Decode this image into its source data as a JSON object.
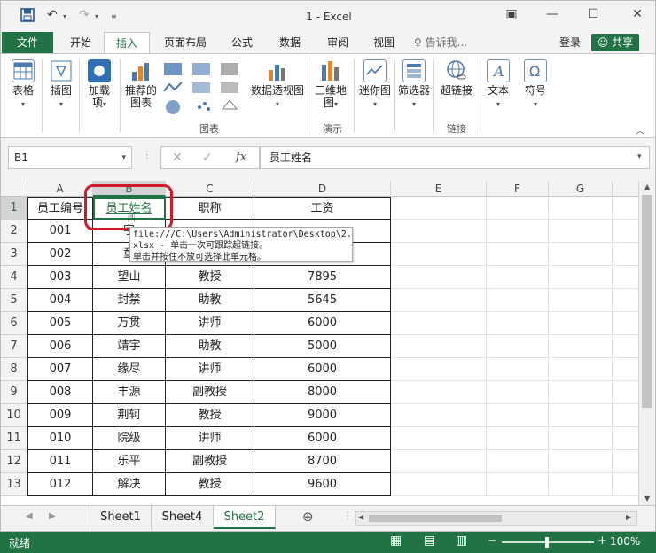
{
  "window": {
    "title": "1 - Excel",
    "quick_access": [
      "save-icon",
      "undo-icon",
      "redo-icon",
      "customize-icon"
    ]
  },
  "menu": {
    "file": "文件",
    "tabs": [
      "开始",
      "插入",
      "页面布局",
      "公式",
      "数据",
      "审阅",
      "视图"
    ],
    "active_tab": "插入",
    "tell_me": "告诉我...",
    "login": "登录",
    "share": "共享"
  },
  "ribbon": {
    "table": "表格",
    "illustrations": "插图",
    "addins_1": "加载",
    "addins_2": "项",
    "recommended_1": "推荐的",
    "recommended_2": "图表",
    "pivotchart": "数据透视图",
    "map3d_1": "三维地",
    "map3d_2": "图",
    "sparkline": "迷你图",
    "filter": "筛选器",
    "hyperlink": "超链接",
    "text": "文本",
    "symbol": "符号",
    "group_charts": "图表",
    "group_tours": "演示",
    "group_links": "链接"
  },
  "formula_bar": {
    "name_box": "B1",
    "fx": "fx",
    "content": "员工姓名"
  },
  "columns": [
    "A",
    "B",
    "C",
    "D",
    "E",
    "F",
    "G"
  ],
  "rows": [
    "1",
    "2",
    "3",
    "4",
    "5",
    "6",
    "7",
    "8",
    "9",
    "10",
    "11",
    "12",
    "13"
  ],
  "table": {
    "headers": [
      "员工编号",
      "员工姓名",
      "职称",
      "工资"
    ],
    "rows": [
      [
        "001",
        "字",
        "",
        ""
      ],
      [
        "002",
        "童",
        "",
        ""
      ],
      [
        "003",
        "望山",
        "教授",
        "7895"
      ],
      [
        "004",
        "封禁",
        "助教",
        "5645"
      ],
      [
        "005",
        "万贯",
        "讲师",
        "6000"
      ],
      [
        "006",
        "靖宇",
        "助教",
        "5000"
      ],
      [
        "007",
        "缘尽",
        "讲师",
        "6000"
      ],
      [
        "008",
        "丰源",
        "副教授",
        "8000"
      ],
      [
        "009",
        "荆轲",
        "教授",
        "9000"
      ],
      [
        "010",
        "院级",
        "讲师",
        "6000"
      ],
      [
        "011",
        "乐平",
        "副教授",
        "8700"
      ],
      [
        "012",
        "解决",
        "教授",
        "9600"
      ]
    ]
  },
  "tooltip": {
    "line1": "file:///C:\\Users\\Administrator\\Desktop\\2.",
    "line2": "xlsx - 单击一次可跟踪超链接。",
    "line3": "单击并按住不放可选择此单元格。"
  },
  "sheets": [
    "Sheet1",
    "Sheet4",
    "Sheet2"
  ],
  "active_sheet": "Sheet2",
  "status": {
    "ready": "就绪",
    "zoom": "100%"
  },
  "colors": {
    "accent": "#217346",
    "highlight": "#d0192a"
  }
}
